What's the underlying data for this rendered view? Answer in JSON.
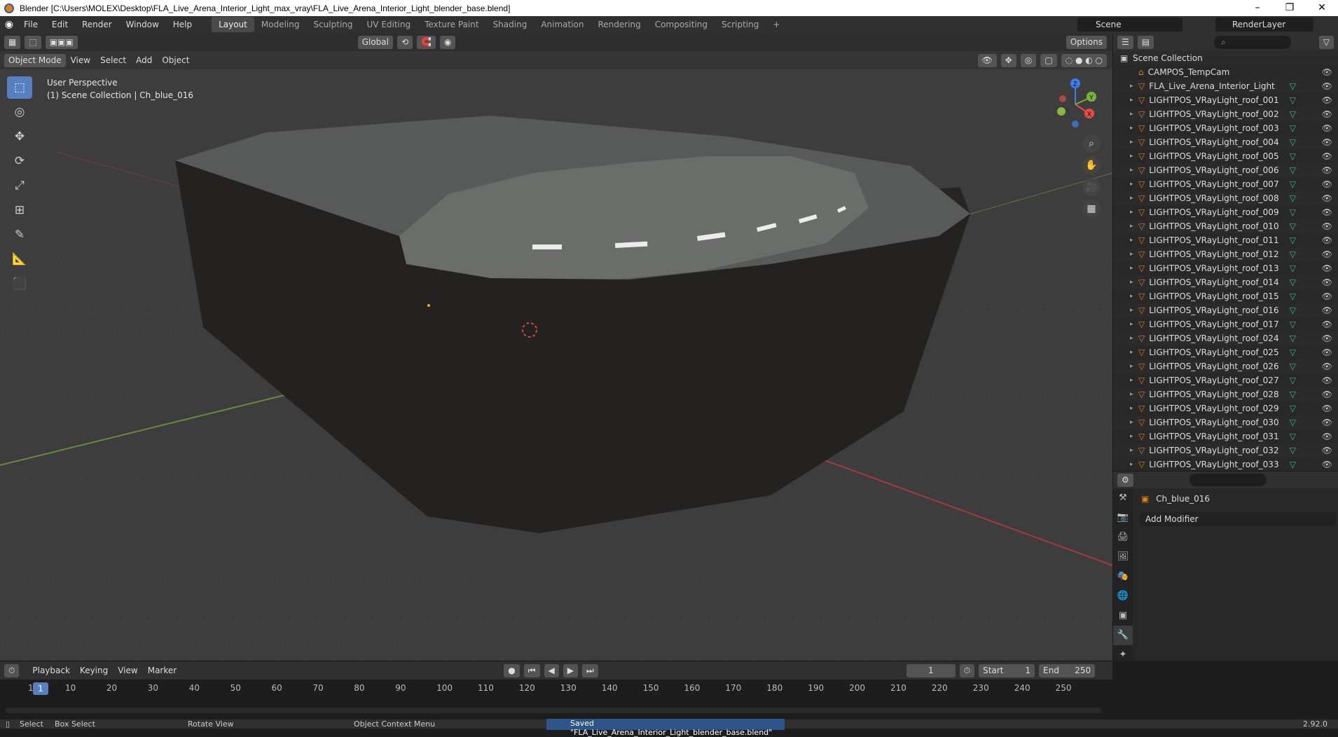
{
  "titlebar": {
    "title": "Blender [C:\\Users\\MOLEX\\Desktop\\FLA_Live_Arena_Interior_Light_max_vray\\FLA_Live_Arena_Interior_Light_blender_base.blend]",
    "minimize": "–",
    "maximize": "❐",
    "close": "✕"
  },
  "topbar": {
    "menus": [
      "File",
      "Edit",
      "Render",
      "Window",
      "Help"
    ],
    "workspaces": [
      "Layout",
      "Modeling",
      "Sculpting",
      "UV Editing",
      "Texture Paint",
      "Shading",
      "Animation",
      "Rendering",
      "Compositing",
      "Scripting"
    ],
    "active_workspace": "Layout",
    "add_tab": "+",
    "scene": "Scene",
    "render_layer": "RenderLayer"
  },
  "viewport": {
    "mode": "Object Mode",
    "menus": [
      "View",
      "Select",
      "Add",
      "Object"
    ],
    "orientation": "Global",
    "options": "Options",
    "perspective": "User Perspective",
    "collection_info": "(1) Scene Collection | Ch_blue_016",
    "gizmo": {
      "x": "X",
      "y": "Y",
      "z": "Z"
    }
  },
  "outliner": {
    "root": "Scene Collection",
    "items": [
      "CAMPOS_TempCam",
      "FLA_Live_Arena_Interior_Light",
      "LIGHTPOS_VRayLight_roof_001",
      "LIGHTPOS_VRayLight_roof_002",
      "LIGHTPOS_VRayLight_roof_003",
      "LIGHTPOS_VRayLight_roof_004",
      "LIGHTPOS_VRayLight_roof_005",
      "LIGHTPOS_VRayLight_roof_006",
      "LIGHTPOS_VRayLight_roof_007",
      "LIGHTPOS_VRayLight_roof_008",
      "LIGHTPOS_VRayLight_roof_009",
      "LIGHTPOS_VRayLight_roof_010",
      "LIGHTPOS_VRayLight_roof_011",
      "LIGHTPOS_VRayLight_roof_012",
      "LIGHTPOS_VRayLight_roof_013",
      "LIGHTPOS_VRayLight_roof_014",
      "LIGHTPOS_VRayLight_roof_015",
      "LIGHTPOS_VRayLight_roof_016",
      "LIGHTPOS_VRayLight_roof_017",
      "LIGHTPOS_VRayLight_roof_024",
      "LIGHTPOS_VRayLight_roof_025",
      "LIGHTPOS_VRayLight_roof_026",
      "LIGHTPOS_VRayLight_roof_027",
      "LIGHTPOS_VRayLight_roof_028",
      "LIGHTPOS_VRayLight_roof_029",
      "LIGHTPOS_VRayLight_roof_030",
      "LIGHTPOS_VRayLight_roof_031",
      "LIGHTPOS_VRayLight_roof_032",
      "LIGHTPOS_VRayLight_roof_033"
    ]
  },
  "properties": {
    "object": "Ch_blue_016",
    "add_modifier": "Add Modifier"
  },
  "timeline": {
    "menus": [
      "Playback",
      "Keying",
      "View",
      "Marker"
    ],
    "current_frame": "1",
    "start_label": "Start",
    "start": "1",
    "end_label": "End",
    "end": "250",
    "ticks": [
      "1",
      "10",
      "20",
      "30",
      "40",
      "50",
      "60",
      "70",
      "80",
      "90",
      "100",
      "110",
      "120",
      "130",
      "140",
      "150",
      "160",
      "170",
      "180",
      "190",
      "200",
      "210",
      "220",
      "230",
      "240",
      "250"
    ]
  },
  "statusbar": {
    "select": "Select",
    "box_select": "Box Select",
    "rotate_view": "Rotate View",
    "context_menu": "Object Context Menu",
    "message": "Saved \"FLA_Live_Arena_Interior_Light_blender_base.blend\"",
    "version": "2.92.0"
  },
  "colors": {
    "accent": "#5680c2",
    "viewport_bg": "#3d3d3d",
    "panel_bg": "#282828",
    "orange": "#e87d0d",
    "mesh_green": "#2ac1a3"
  }
}
